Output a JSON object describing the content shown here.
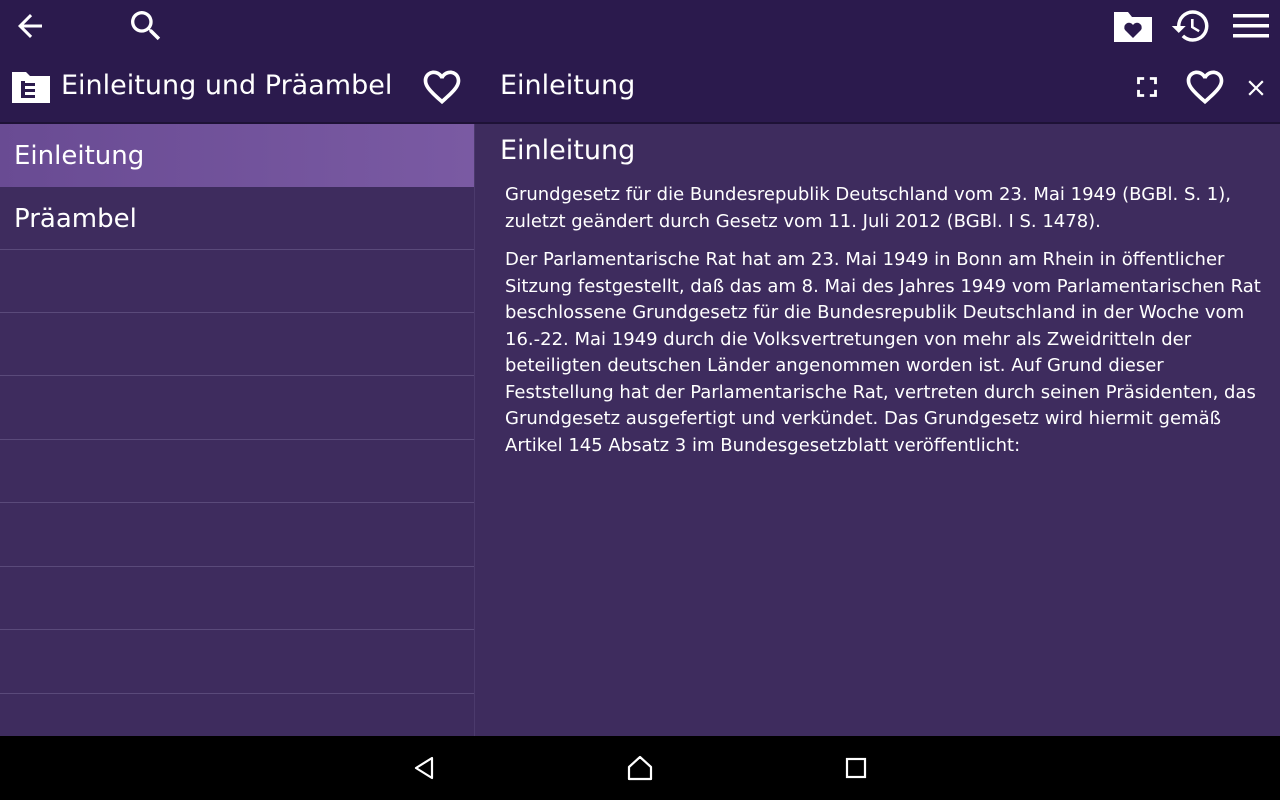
{
  "toolbar": {
    "back_icon": "arrow-left-icon",
    "search_icon": "search-icon",
    "favorites_folder_icon": "heart-folder-icon",
    "history_icon": "history-icon",
    "menu_icon": "menu-icon"
  },
  "left_header": {
    "title": "Einleitung und Präambel",
    "folder_icon": "folder-tree-icon",
    "favorite_icon": "heart-outline-icon"
  },
  "right_header": {
    "title": "Einleitung",
    "fullscreen_icon": "fullscreen-icon",
    "favorite_icon": "heart-outline-icon",
    "close_icon": "close-icon"
  },
  "sidebar": {
    "items": [
      {
        "label": "Einleitung",
        "selected": true
      },
      {
        "label": "Präambel",
        "selected": false
      }
    ]
  },
  "content": {
    "heading": "Einleitung",
    "paragraphs": [
      "Grundgesetz für die Bundesrepublik Deutschland vom 23. Mai 1949 (BGBl. S. 1), zuletzt geändert durch Gesetz vom 11. Juli 2012 (BGBl. I S. 1478).",
      "Der Parlamentarische Rat hat am 23. Mai 1949 in Bonn am Rhein in öffentlicher Sitzung festgestellt, daß das am 8. Mai des Jahres 1949 vom Parlamentarischen Rat beschlossene Grundgesetz für die Bundesrepublik Deutschland in der Woche vom 16.-22. Mai 1949 durch die Volksvertretungen von mehr als Zweidritteln der beteiligten deutschen Länder angenommen worden ist. Auf Grund dieser Feststellung hat der Parlamentarische Rat, vertreten durch seinen Präsidenten, das Grundgesetz ausgefertigt und verkündet. Das Grundgesetz wird hiermit gemäß Artikel 145 Absatz 3 im Bundesgesetzblatt veröffentlicht:"
    ]
  },
  "navbar": {
    "back_icon": "nav-back-icon",
    "home_icon": "nav-home-icon",
    "recents_icon": "nav-recents-icon"
  },
  "colors": {
    "toolbar_bg": "#2b1a4d",
    "content_bg": "#3e2c5e",
    "selected_item": "#6b4c95",
    "navbar_bg": "#000000"
  }
}
